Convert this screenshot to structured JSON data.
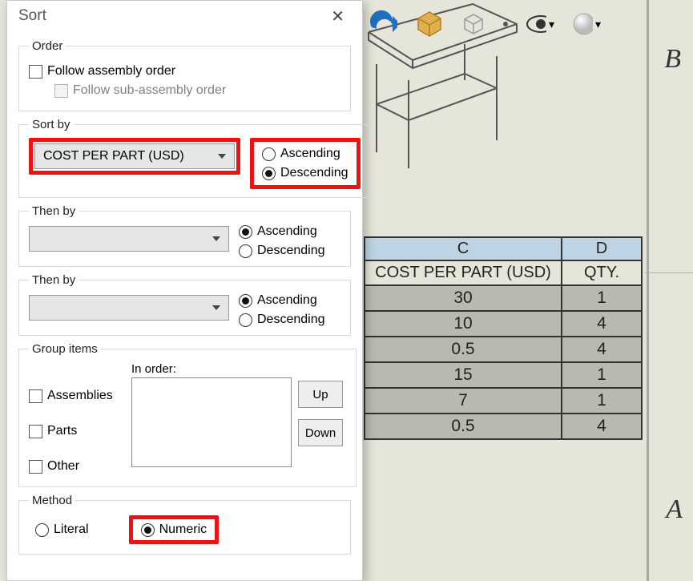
{
  "dialog": {
    "title": "Sort",
    "order": {
      "legend": "Order",
      "followAssembly": "Follow assembly order",
      "followSub": "Follow sub-assembly order"
    },
    "sortBy": {
      "legend": "Sort by",
      "value": "COST PER PART (USD)",
      "asc": "Ascending",
      "desc": "Descending"
    },
    "thenBy1": {
      "legend": "Then by",
      "asc": "Ascending",
      "desc": "Descending"
    },
    "thenBy2": {
      "legend": "Then by",
      "asc": "Ascending",
      "desc": "Descending"
    },
    "group": {
      "legend": "Group items",
      "inOrder": "In order:",
      "assemblies": "Assemblies",
      "parts": "Parts",
      "other": "Other",
      "up": "Up",
      "down": "Down"
    },
    "method": {
      "legend": "Method",
      "literal": "Literal",
      "numeric": "Numeric"
    }
  },
  "axis": {
    "a": "A",
    "b": "B"
  },
  "table": {
    "colC": "C",
    "colD": "D",
    "headerC": "COST PER PART (USD)",
    "headerD": "QTY.",
    "rows": [
      {
        "c": "30",
        "d": "1"
      },
      {
        "c": "10",
        "d": "4"
      },
      {
        "c": "0.5",
        "d": "4"
      },
      {
        "c": "15",
        "d": "1"
      },
      {
        "c": "7",
        "d": "1"
      },
      {
        "c": "0.5",
        "d": "4"
      }
    ]
  }
}
